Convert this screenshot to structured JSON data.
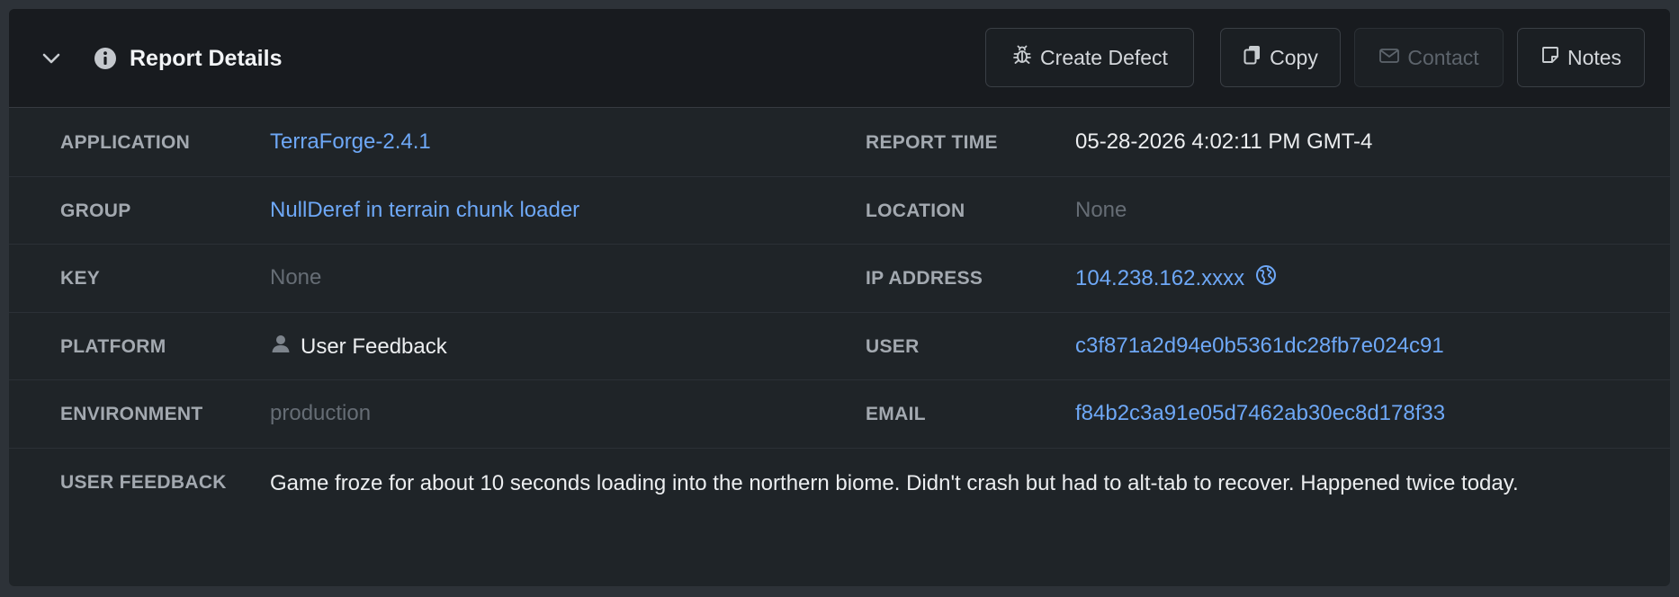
{
  "header": {
    "title": "Report Details",
    "buttons": {
      "create_defect": "Create Defect",
      "copy": "Copy",
      "contact": "Contact",
      "notes": "Notes"
    }
  },
  "details": {
    "application": {
      "label": "APPLICATION",
      "value": "TerraForge-2.4.1"
    },
    "report_time": {
      "label": "REPORT TIME",
      "value": "05-28-2026 4:02:11 PM GMT-4"
    },
    "group": {
      "label": "GROUP",
      "value": "NullDeref in terrain chunk loader"
    },
    "location": {
      "label": "LOCATION",
      "value": "None"
    },
    "key": {
      "label": "KEY",
      "value": "None"
    },
    "ip_address": {
      "label": "IP ADDRESS",
      "value": "104.238.162.xxxx"
    },
    "platform": {
      "label": "PLATFORM",
      "value": "User Feedback"
    },
    "user": {
      "label": "USER",
      "value": "c3f871a2d94e0b5361dc28fb7e024c91"
    },
    "environment": {
      "label": "ENVIRONMENT",
      "value": "production"
    },
    "email": {
      "label": "EMAIL",
      "value": "f84b2c3a91e05d7462ab30ec8d178f33"
    },
    "user_feedback": {
      "label": "USER FEEDBACK",
      "value": "Game froze for about 10 seconds loading into the northern biome. Didn't crash but had to alt-tab to recover. Happened twice today."
    }
  },
  "icons": {
    "collapse": "chevron-down-icon",
    "info": "info-icon",
    "create_defect": "bug-icon",
    "copy": "copy-icon",
    "contact": "mail-icon",
    "notes": "note-icon",
    "platform": "user-icon",
    "ip_lookup": "globe-icon"
  },
  "colors": {
    "link": "#6ea8f7",
    "muted": "#666d75",
    "panel_bg": "#1f2428",
    "header_bg": "#181b1f"
  }
}
